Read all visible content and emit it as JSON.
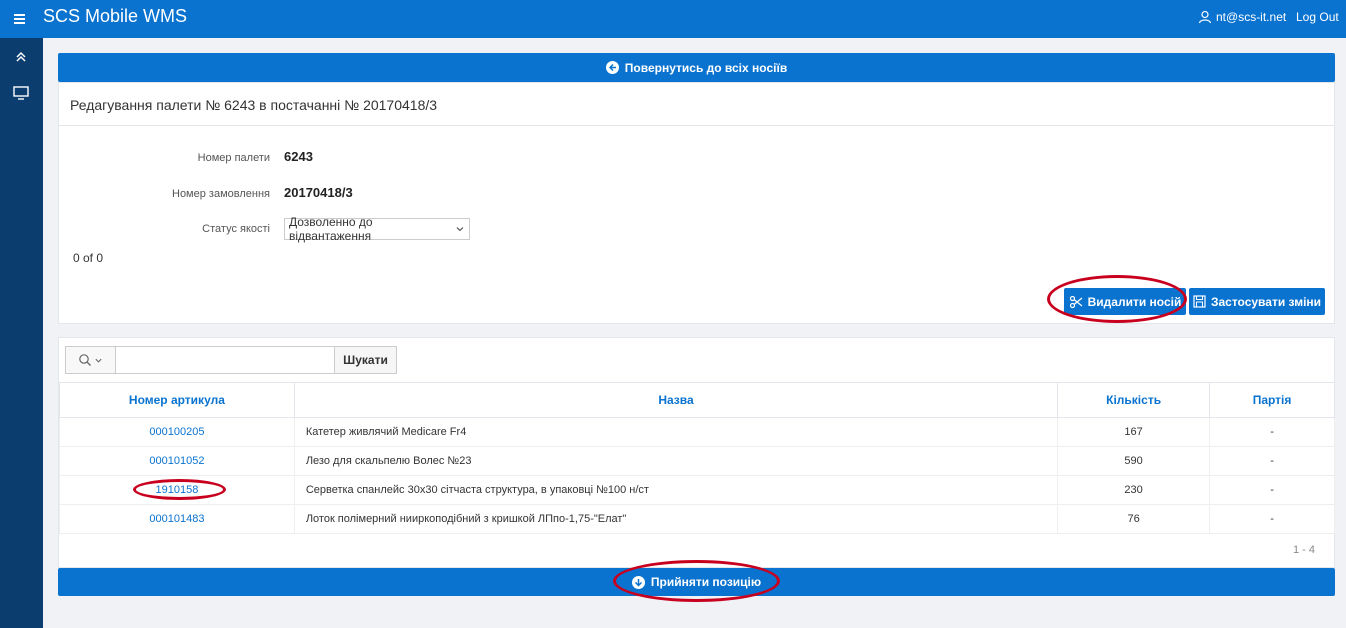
{
  "app": {
    "title": "SCS Mobile WMS",
    "user": "nt@scs-it.net",
    "logout": "Log Out"
  },
  "back_button": "Повернутись до всіх носіїв",
  "edit_panel": {
    "title": "Редагування палети № 6243 в постачанні № 20170418/3",
    "fields": [
      {
        "label": "Номер палети",
        "value": "6243"
      },
      {
        "label": "Номер замовлення",
        "value": "20170418/3"
      }
    ],
    "quality_label": "Статус якості",
    "quality_value": "Дозволенно до відвантаження",
    "counter": "0 of 0",
    "delete_button": "Видалити носій",
    "apply_button": "Застосувати зміни"
  },
  "search": {
    "button": "Шукати",
    "placeholder": ""
  },
  "table": {
    "headers": [
      "Номер артикула",
      "Назва",
      "Кількість",
      "Партія"
    ],
    "rows": [
      {
        "article": "000100205",
        "name": "Катетер живлячий Medicare Fr4",
        "qty": "167",
        "batch": "-"
      },
      {
        "article": "000101052",
        "name": "Лезо для скальпелю Волес №23",
        "qty": "590",
        "batch": "-"
      },
      {
        "article": "1910158",
        "name": "Серветка спанлейс 30х30 сітчаста структура, в упаковці №100 н/ст",
        "qty": "230",
        "batch": "-"
      },
      {
        "article": "000101483",
        "name": "Лоток полімерний нииркоподібний з кришкой ЛПпо-1,75-\"Елат\"",
        "qty": "76",
        "batch": "-"
      }
    ],
    "pager": "1 - 4"
  },
  "accept_button": "Прийняти позицію",
  "colors": {
    "primary": "#0a73cf",
    "sidebar": "#0b3e6e",
    "annotation": "#c8001e"
  }
}
